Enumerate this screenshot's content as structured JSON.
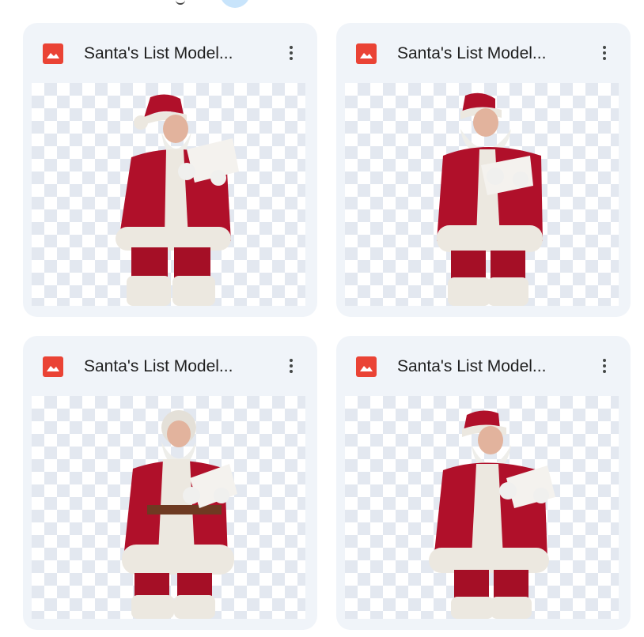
{
  "files": [
    {
      "title": "Santa's List Model...",
      "icon": "image-file-icon",
      "menu_icon": "more-vert-icon"
    },
    {
      "title": "Santa's List Model...",
      "icon": "image-file-icon",
      "menu_icon": "more-vert-icon"
    },
    {
      "title": "Santa's List Model...",
      "icon": "image-file-icon",
      "menu_icon": "more-vert-icon"
    },
    {
      "title": "Santa's List Model...",
      "icon": "image-file-icon",
      "menu_icon": "more-vert-icon"
    }
  ],
  "colors": {
    "card_background": "#f0f4f9",
    "file_icon": "#ea4335",
    "title_text": "#1f1f1f",
    "santa_red": "#b0102a",
    "fur_white": "#ece8e0"
  }
}
